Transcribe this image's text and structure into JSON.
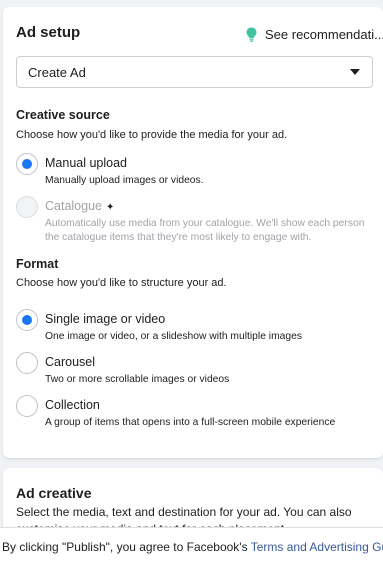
{
  "ad_setup": {
    "title": "Ad setup",
    "recommendations_link": "See recommendati...",
    "dropdown_value": "Create Ad"
  },
  "creative_source": {
    "title": "Creative source",
    "subtitle": "Choose how you'd like to provide the media for your ad.",
    "options": [
      {
        "label": "Manual upload",
        "description": "Manually upload images or videos.",
        "selected": true,
        "disabled": false
      },
      {
        "label": "Catalogue",
        "description": "Automatically use media from your catalogue. We'll show each person the catalogue items that they're most likely to engage with.",
        "selected": false,
        "disabled": true
      }
    ]
  },
  "format": {
    "title": "Format",
    "subtitle": "Choose how you'd like to structure your ad.",
    "options": [
      {
        "label": "Single image or video",
        "description": "One image or video, or a slideshow with multiple images",
        "selected": true
      },
      {
        "label": "Carousel",
        "description": "Two or more scrollable images or videos",
        "selected": false
      },
      {
        "label": "Collection",
        "description": "A group of items that opens into a full-screen mobile experience",
        "selected": false
      }
    ]
  },
  "ad_creative": {
    "title": "Ad creative",
    "description": "Select the media, text and destination for your ad. You can also customise your media and text for each placement."
  },
  "footer": {
    "prefix": "By clicking \"Publish\", you agree to Facebook's ",
    "link_terms": "Terms and Advertising",
    "link_more": "Guidelines"
  },
  "colors": {
    "accent": "#1877f2",
    "bulb": "#42b72a"
  },
  "icons": [
    "lightbulb-icon",
    "chevron-down-icon",
    "sparkle-icon"
  ]
}
